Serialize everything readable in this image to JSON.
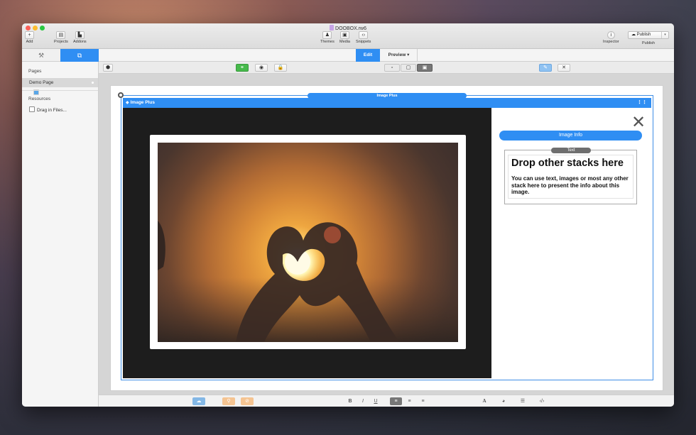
{
  "window": {
    "document_title": "DOOBOX.rw6"
  },
  "toolbar": {
    "add": "Add",
    "projects": "Projects",
    "addons": "Addons",
    "themes": "Themes",
    "media": "Media",
    "snippets": "Snippets",
    "inspector": "Inspector",
    "publish_button": "Publish",
    "publish_label": "Publish"
  },
  "sidebar": {
    "tab_tools_icon": "wrench-icon",
    "tab_pages_icon": "pages-icon",
    "pages_header": "Pages",
    "pages": [
      {
        "label": "Demo Page"
      }
    ],
    "resources_header": "Resources",
    "resources_item": "Drag in Files..."
  },
  "modebar": {
    "edit": "Edit",
    "preview": "Preview"
  },
  "stack": {
    "outer_label": "Image Plus",
    "header_label": "Image Plus",
    "info_button": "Image Info",
    "text_badge": "Text",
    "drop_title": "Drop other stacks here",
    "drop_body": "You can use text, images or most any other stack here to present the info about this image."
  },
  "colors": {
    "accent": "#2f8ef3",
    "green": "#46b94b",
    "canvas": "#d5d5d5"
  }
}
